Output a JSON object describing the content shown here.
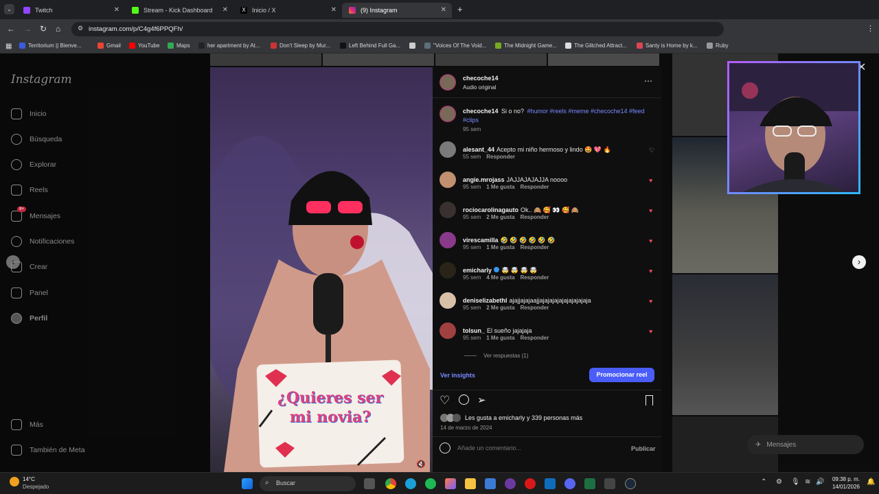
{
  "browser": {
    "tabs": [
      {
        "title": "Twitch",
        "color": "#9146ff"
      },
      {
        "title": "Stream - Kick Dashboard",
        "color": "#53fc18"
      },
      {
        "title": "Inicio / X",
        "color": "#e7e9ea"
      },
      {
        "title": "(9) Instagram",
        "color": "#e1306c"
      }
    ],
    "new_tab": "+",
    "url": "instagram.com/p/C4g4f6PPQFh/",
    "bookmarks": [
      {
        "label": "Territorium || Bienve...",
        "color": "#3b5bdb"
      },
      {
        "label": "Gmail",
        "color": "#ea4335"
      },
      {
        "label": "YouTube",
        "color": "#ff0000"
      },
      {
        "label": "Maps",
        "color": "#34a853"
      },
      {
        "label": "her apartment by At...",
        "color": "#222222"
      },
      {
        "label": "Don't Sleep by Mur...",
        "color": "#cc3333"
      },
      {
        "label": "Left Behind Full Ga...",
        "color": "#111111"
      },
      {
        "label": "",
        "color": "#cccccc"
      },
      {
        "label": "\"Voices Of The Void...",
        "color": "#5c6f7a"
      },
      {
        "label": "The Midnight Game...",
        "color": "#77aa22"
      },
      {
        "label": "The Glitched Attract...",
        "color": "#dddddd"
      },
      {
        "label": "Santy is Home by k...",
        "color": "#dd4455"
      },
      {
        "label": "Ruby",
        "color": "#999999"
      }
    ]
  },
  "sidebar": {
    "logo": "Instagram",
    "items": [
      {
        "label": "Inicio",
        "icon": "home-icon"
      },
      {
        "label": "Búsqueda",
        "icon": "search-icon"
      },
      {
        "label": "Explorar",
        "icon": "compass-icon"
      },
      {
        "label": "Reels",
        "icon": "reels-icon"
      },
      {
        "label": "Mensajes",
        "icon": "messenger-icon",
        "badge": "9+"
      },
      {
        "label": "Notificaciones",
        "icon": "heart-icon"
      },
      {
        "label": "Crear",
        "icon": "plus-icon"
      },
      {
        "label": "Panel",
        "icon": "chart-icon"
      },
      {
        "label": "Perfil",
        "icon": "avatar-icon"
      }
    ],
    "bottom": [
      {
        "label": "Más",
        "icon": "menu-icon"
      },
      {
        "label": "También de Meta",
        "icon": "meta-icon"
      }
    ]
  },
  "post": {
    "username": "checoche14",
    "audio": "Audio original",
    "caption": {
      "user": "checoche14",
      "text": "Si o no?",
      "tags": "#humor #reels #meme #checoche14 #feed #clips",
      "time": "95 sem"
    },
    "comments": [
      {
        "user": "alesant_44",
        "text": "Acepto mi niño hermoso y lindo 🤩 💖 🔥",
        "time": "55 sem",
        "likes": "",
        "reply": "Responder",
        "liked": false,
        "color": "#7a7a7a"
      },
      {
        "user": "angie.mrojass",
        "text": "JAJJAJAJAJJA noooo",
        "time": "95 sem",
        "likes": "1 Me gusta",
        "reply": "Responder",
        "liked": true,
        "color": "#c09070"
      },
      {
        "user": "rociocarolinagauto",
        "text": "Ok.. 🙈 🥰 👀 🥰 🙈",
        "time": "95 sem",
        "likes": "2 Me gusta",
        "reply": "Responder",
        "liked": true,
        "color": "#3a3030"
      },
      {
        "user": "virescamilla",
        "text": "🤣 🤣 🤣 🤣 🤣 🤣",
        "time": "95 sem",
        "likes": "1 Me gusta",
        "reply": "Responder",
        "liked": true,
        "color": "#8a3a8a"
      },
      {
        "user": "emicharly",
        "text": "🤯 🤯 🤯 🤯",
        "time": "95 sem",
        "likes": "4 Me gusta",
        "reply": "Responder",
        "liked": true,
        "color": "#2a2418",
        "verified": true
      },
      {
        "user": "deniselizabethl",
        "text": "ajajjajajaajjajajajajajajajajajaja",
        "time": "95 sem",
        "likes": "2 Me gusta",
        "reply": "Responder",
        "liked": true,
        "color": "#d8c0a8"
      },
      {
        "user": "tolsun_",
        "text": "El sueño jajajaja",
        "time": "95 sem",
        "likes": "1 Me gusta",
        "reply": "Responder",
        "liked": true,
        "color": "#a04040"
      }
    ],
    "view_replies": "Ver respuestas (1)",
    "insights": "Ver insights",
    "promote": "Promocionar reel",
    "likes_text": "Les gusta a emicharly y 339 personas más",
    "date": "14 de marzo de 2024",
    "comment_placeholder": "Añade un comentario...",
    "publish": "Publicar"
  },
  "video_card_text": "¿Quieres ser mi novia?",
  "bg_messages": "Mensajes",
  "taskbar": {
    "weather_temp": "14°C",
    "weather_desc": "Despejado",
    "search": "Buscar",
    "time": "09:38 p. m.",
    "date": "14/01/2026"
  }
}
